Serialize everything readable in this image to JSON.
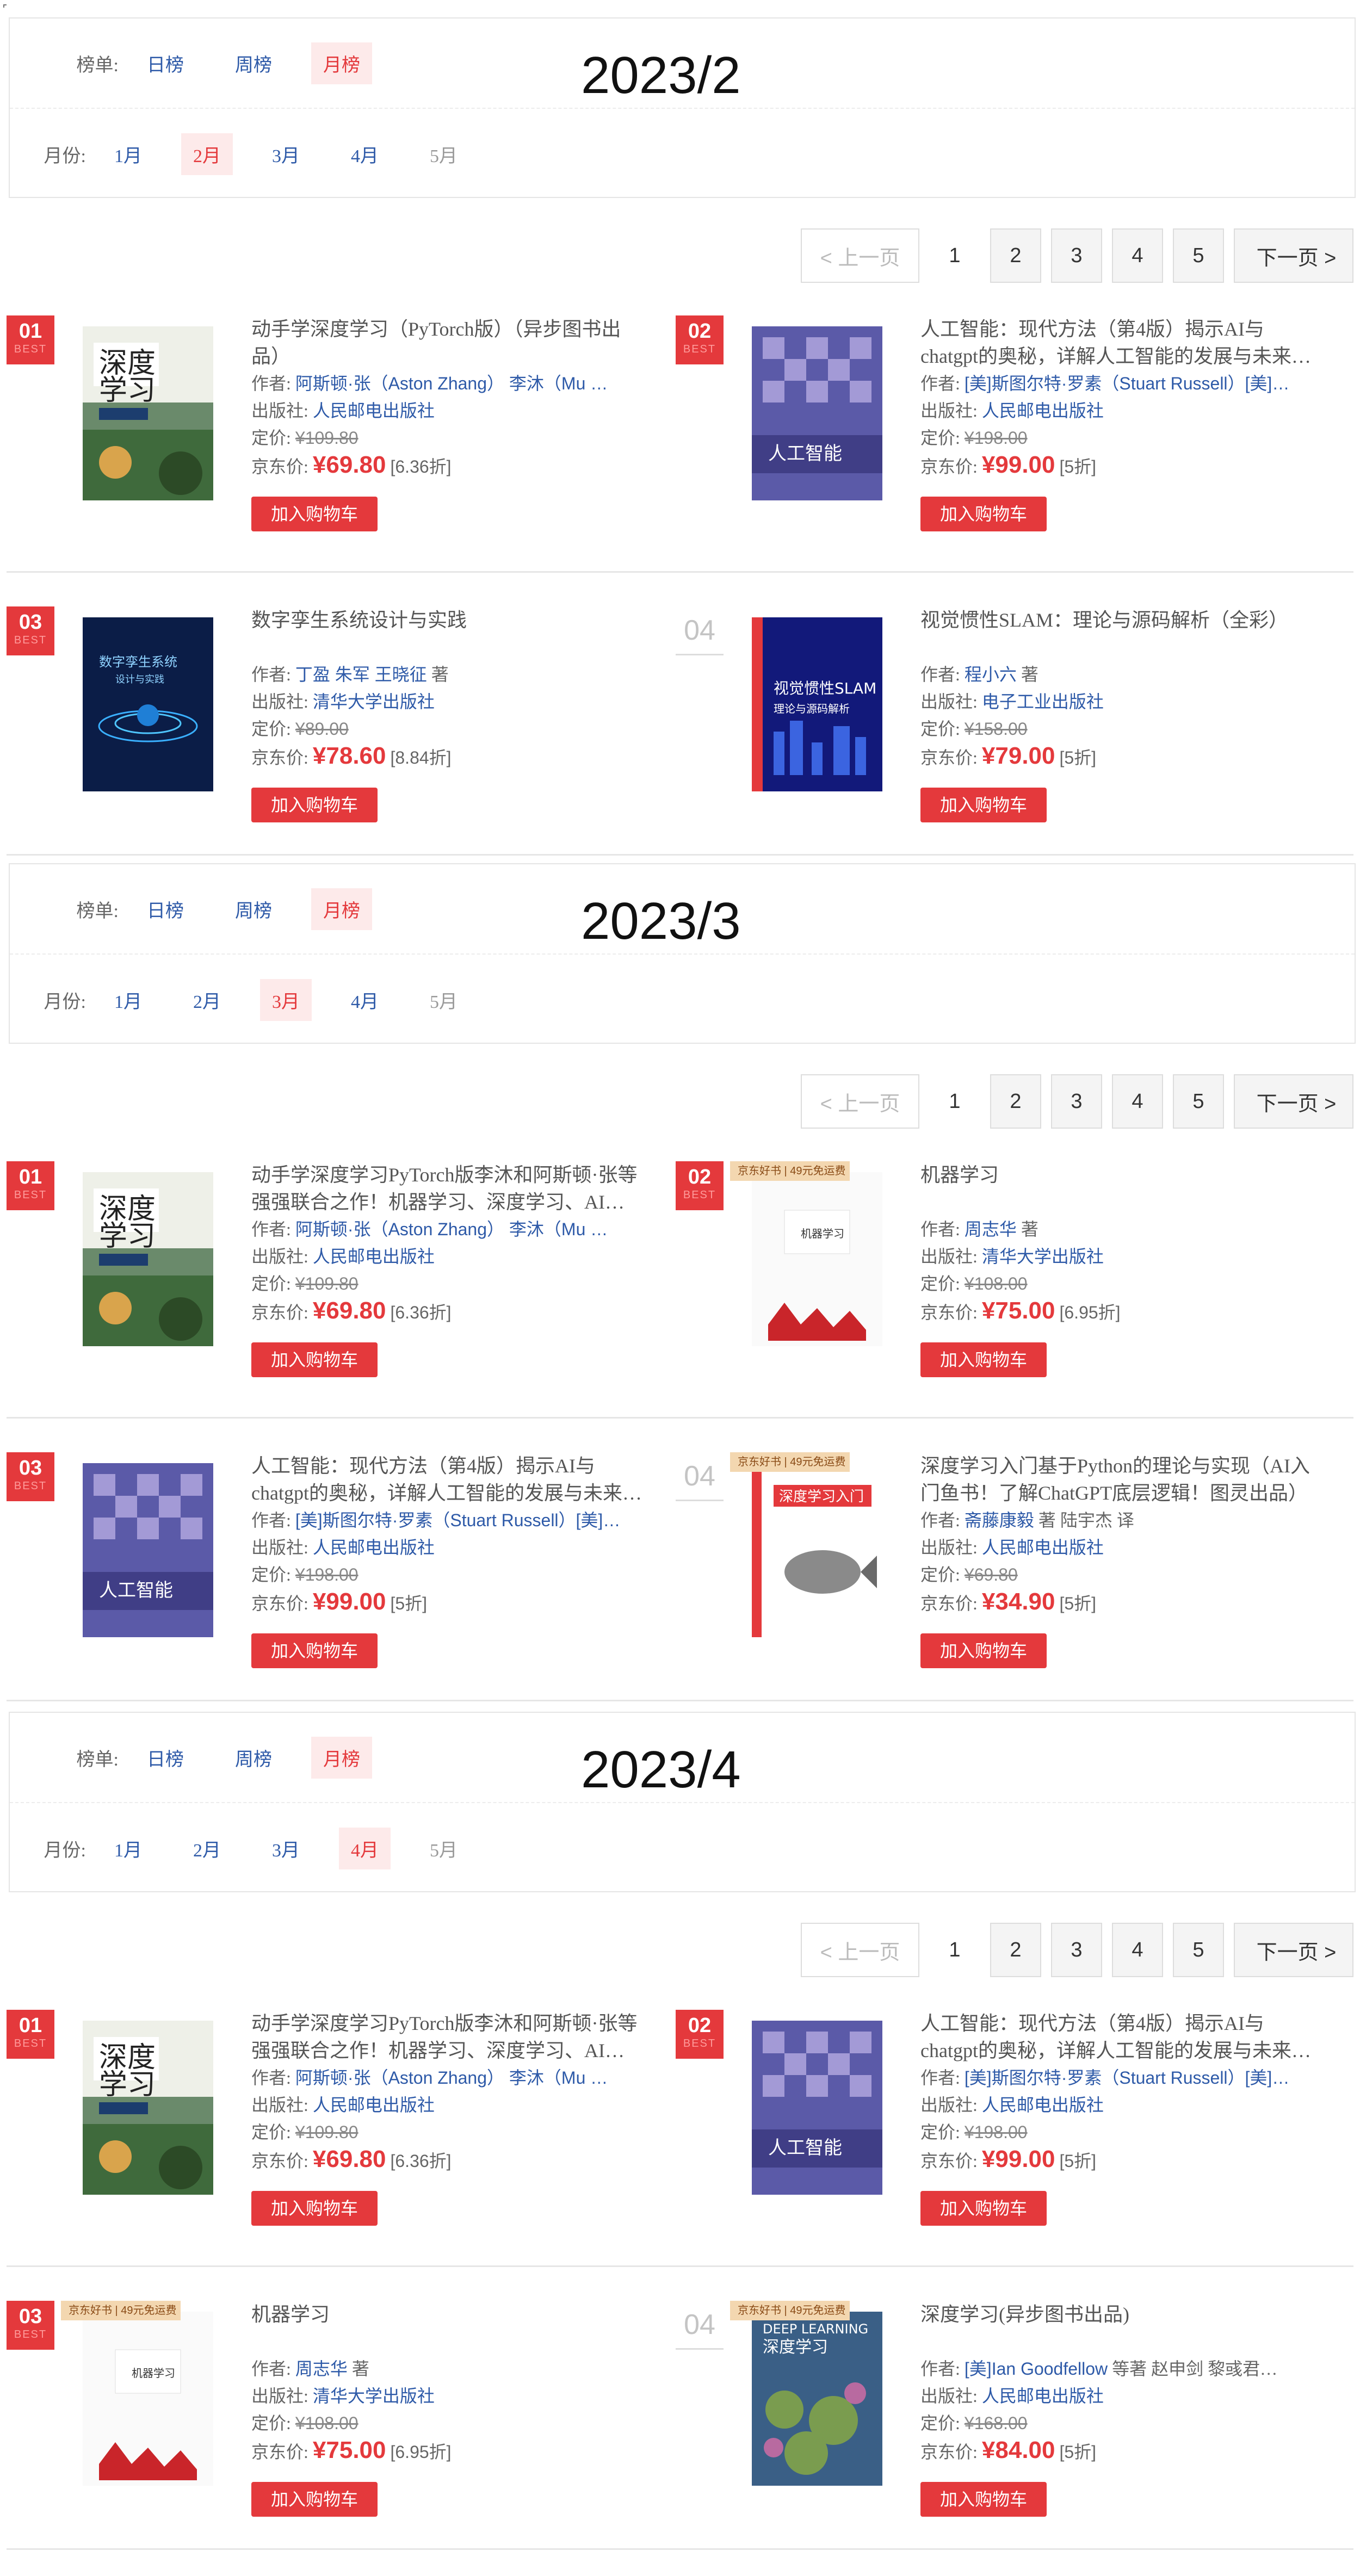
{
  "sections": [
    {
      "heading": "2023/2",
      "rank_label": "榜单:",
      "rank_tabs": [
        "日榜",
        "周榜",
        "月榜"
      ],
      "active_tab": 2,
      "month_label": "月份:",
      "months": [
        "1月",
        "2月",
        "3月",
        "4月",
        "5月"
      ],
      "active_month": 1,
      "pager": {
        "prev": "< 上一页",
        "pages": [
          "1",
          "2",
          "3",
          "4",
          "5"
        ],
        "next": "下一页 >"
      },
      "books": [
        {
          "rank": "01",
          "best": "BEST",
          "title": "动手学深度学习（PyTorch版）（异步图书出品）",
          "author_label": "作者:",
          "authors": "阿斯顿·张（Aston Zhang） 李沐（Mu …",
          "author_suffix": "",
          "publisher_label": "出版社:",
          "publisher": "人民邮电出版社",
          "list_label": "定价:",
          "list_price": "¥109.80",
          "jd_label": "京东价:",
          "jd_price": "¥69.80",
          "discount": "[6.36折]",
          "cart": "加入购物车",
          "cover": "dl1"
        },
        {
          "rank": "02",
          "best": "BEST",
          "title": "人工智能：现代方法（第4版）揭示AI与chatgpt的奥秘，详解人工智能的发展与未来…",
          "author_label": "作者:",
          "authors": "[美]斯图尔特·罗素（Stuart Russell）[美]…",
          "author_suffix": "",
          "publisher_label": "出版社:",
          "publisher": "人民邮电出版社",
          "list_label": "定价:",
          "list_price": "¥198.00",
          "jd_label": "京东价:",
          "jd_price": "¥99.00",
          "discount": "[5折]",
          "cart": "加入购物车",
          "cover": "ai"
        },
        {
          "rank": "03",
          "best": "BEST",
          "title": "数字孪生系统设计与实践",
          "author_label": "作者:",
          "authors": "丁盈 朱军 王晓征",
          "author_suffix": "著",
          "publisher_label": "出版社:",
          "publisher": "清华大学出版社",
          "list_label": "定价:",
          "list_price": "¥89.00",
          "jd_label": "京东价:",
          "jd_price": "¥78.60",
          "discount": "[8.84折]",
          "cart": "加入购物车",
          "cover": "twin"
        },
        {
          "rank": "04",
          "best": "",
          "title": "视觉惯性SLAM：理论与源码解析（全彩）",
          "author_label": "作者:",
          "authors": "程小六",
          "author_suffix": "著",
          "publisher_label": "出版社:",
          "publisher": "电子工业出版社",
          "list_label": "定价:",
          "list_price": "¥158.00",
          "jd_label": "京东价:",
          "jd_price": "¥79.00",
          "discount": "[5折]",
          "cart": "加入购物车",
          "cover": "slam"
        }
      ]
    },
    {
      "heading": "2023/3",
      "rank_label": "榜单:",
      "rank_tabs": [
        "日榜",
        "周榜",
        "月榜"
      ],
      "active_tab": 2,
      "month_label": "月份:",
      "months": [
        "1月",
        "2月",
        "3月",
        "4月",
        "5月"
      ],
      "active_month": 2,
      "pager": {
        "prev": "< 上一页",
        "pages": [
          "1",
          "2",
          "3",
          "4",
          "5"
        ],
        "next": "下一页 >"
      },
      "books": [
        {
          "rank": "01",
          "best": "BEST",
          "title": "动手学深度学习PyTorch版李沐和阿斯顿·张等强强联合之作！机器学习、深度学习、AI…",
          "author_label": "作者:",
          "authors": "阿斯顿·张（Aston Zhang） 李沐（Mu …",
          "author_suffix": "",
          "publisher_label": "出版社:",
          "publisher": "人民邮电出版社",
          "list_label": "定价:",
          "list_price": "¥109.80",
          "jd_label": "京东价:",
          "jd_price": "¥69.80",
          "discount": "[6.36折]",
          "cart": "加入购物车",
          "cover": "dl1"
        },
        {
          "rank": "02",
          "best": "BEST",
          "title": "机器学习",
          "author_label": "作者:",
          "authors": "周志华",
          "author_suffix": "著",
          "publisher_label": "出版社:",
          "publisher": "清华大学出版社",
          "list_label": "定价:",
          "list_price": "¥108.00",
          "jd_label": "京东价:",
          "jd_price": "¥75.00",
          "discount": "[6.95折]",
          "cart": "加入购物车",
          "cover": "ml",
          "tag": "京东好书 | 49元免运费"
        },
        {
          "rank": "03",
          "best": "BEST",
          "title": "人工智能：现代方法（第4版）揭示AI与chatgpt的奥秘，详解人工智能的发展与未来…",
          "author_label": "作者:",
          "authors": "[美]斯图尔特·罗素（Stuart Russell）[美]…",
          "author_suffix": "",
          "publisher_label": "出版社:",
          "publisher": "人民邮电出版社",
          "list_label": "定价:",
          "list_price": "¥198.00",
          "jd_label": "京东价:",
          "jd_price": "¥99.00",
          "discount": "[5折]",
          "cart": "加入购物车",
          "cover": "ai"
        },
        {
          "rank": "04",
          "best": "",
          "title": "深度学习入门基于Python的理论与实现（AI入门鱼书！了解ChatGPT底层逻辑！图灵出品）",
          "author_label": "作者:",
          "authors": "斋藤康毅",
          "author_suffix": "著 陆宇杰 译",
          "publisher_label": "出版社:",
          "publisher": "人民邮电出版社",
          "list_label": "定价:",
          "list_price": "¥69.80",
          "jd_label": "京东价:",
          "jd_price": "¥34.90",
          "discount": "[5折]",
          "cart": "加入购物车",
          "cover": "fish",
          "tag": "京东好书 | 49元免运费"
        }
      ]
    },
    {
      "heading": "2023/4",
      "rank_label": "榜单:",
      "rank_tabs": [
        "日榜",
        "周榜",
        "月榜"
      ],
      "active_tab": 2,
      "month_label": "月份:",
      "months": [
        "1月",
        "2月",
        "3月",
        "4月",
        "5月"
      ],
      "active_month": 3,
      "pager": {
        "prev": "< 上一页",
        "pages": [
          "1",
          "2",
          "3",
          "4",
          "5"
        ],
        "next": "下一页 >"
      },
      "books": [
        {
          "rank": "01",
          "best": "BEST",
          "title": "动手学深度学习PyTorch版李沐和阿斯顿·张等强强联合之作！机器学习、深度学习、AI…",
          "author_label": "作者:",
          "authors": "阿斯顿·张（Aston Zhang） 李沐（Mu …",
          "author_suffix": "",
          "publisher_label": "出版社:",
          "publisher": "人民邮电出版社",
          "list_label": "定价:",
          "list_price": "¥109.80",
          "jd_label": "京东价:",
          "jd_price": "¥69.80",
          "discount": "[6.36折]",
          "cart": "加入购物车",
          "cover": "dl1"
        },
        {
          "rank": "02",
          "best": "BEST",
          "title": "人工智能：现代方法（第4版）揭示AI与chatgpt的奥秘，详解人工智能的发展与未来…",
          "author_label": "作者:",
          "authors": "[美]斯图尔特·罗素（Stuart Russell）[美]…",
          "author_suffix": "",
          "publisher_label": "出版社:",
          "publisher": "人民邮电出版社",
          "list_label": "定价:",
          "list_price": "¥198.00",
          "jd_label": "京东价:",
          "jd_price": "¥99.00",
          "discount": "[5折]",
          "cart": "加入购物车",
          "cover": "ai"
        },
        {
          "rank": "03",
          "best": "BEST",
          "title": "机器学习",
          "author_label": "作者:",
          "authors": "周志华",
          "author_suffix": "著",
          "publisher_label": "出版社:",
          "publisher": "清华大学出版社",
          "list_label": "定价:",
          "list_price": "¥108.00",
          "jd_label": "京东价:",
          "jd_price": "¥75.00",
          "discount": "[6.95折]",
          "cart": "加入购物车",
          "cover": "ml",
          "tag": "京东好书 | 49元免运费"
        },
        {
          "rank": "04",
          "best": "",
          "title": "深度学习(异步图书出品)",
          "author_label": "作者:",
          "authors": "[美]Ian Goodfellow",
          "author_suffix": "等著 赵申剑 黎彧君…",
          "publisher_label": "出版社:",
          "publisher": "人民邮电出版社",
          "list_label": "定价:",
          "list_price": "¥168.00",
          "jd_label": "京东价:",
          "jd_price": "¥84.00",
          "discount": "[5折]",
          "cart": "加入购物车",
          "cover": "deep",
          "tag": "京东好书 | 49元免运费"
        }
      ]
    }
  ],
  "colors": {
    "accent": "#e4393c",
    "link": "#2e5aa8",
    "active_bg": "#fdeaea"
  }
}
